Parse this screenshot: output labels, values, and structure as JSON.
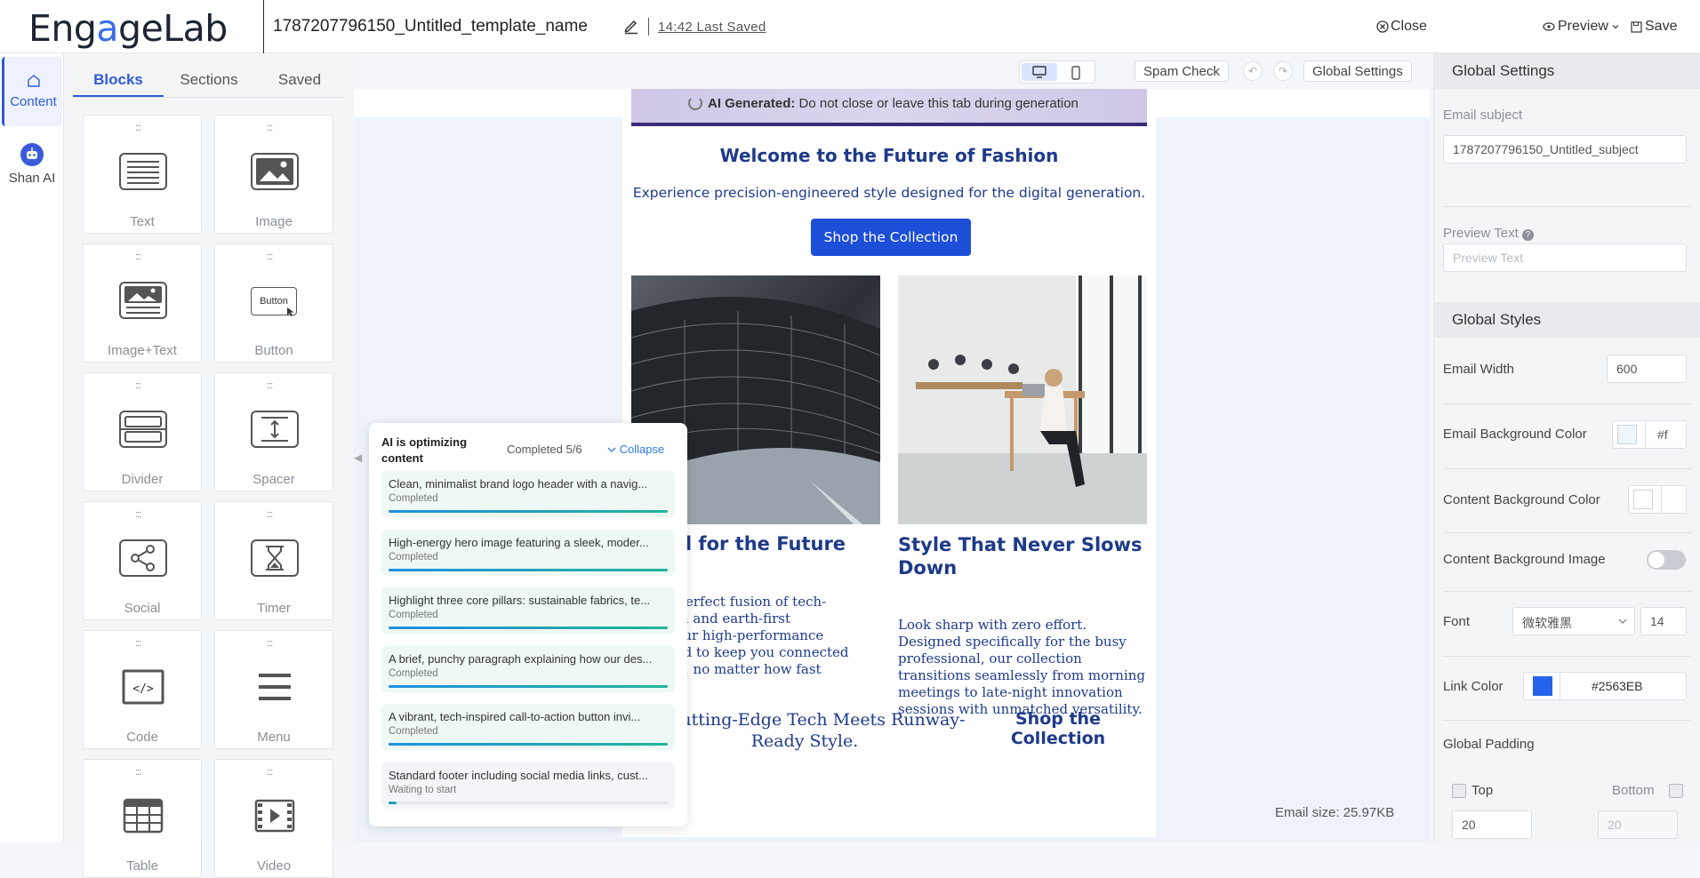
{
  "app": {
    "logo": "EngageLab",
    "template_name": "1787207796150_Untitled_template_name",
    "last_saved": "14:42 Last Saved",
    "close_label": "Close",
    "preview_label": "Preview",
    "save_label": "Save"
  },
  "left_rail": {
    "items": [
      {
        "label": "Content",
        "icon": "content-icon",
        "active": true
      },
      {
        "label": "Shan AI",
        "icon": "robot-icon",
        "active": false
      }
    ]
  },
  "blocks_panel": {
    "tabs": [
      "Blocks",
      "Sections",
      "Saved"
    ],
    "active_tab": "Blocks",
    "blocks": [
      "Text",
      "Image",
      "Image+Text",
      "Button",
      "Divider",
      "Spacer",
      "Social",
      "Timer",
      "Code",
      "Menu",
      "Table",
      "Video"
    ],
    "button_icon_text": "Button"
  },
  "canvas_toolbar": {
    "spam_check": "Spam Check",
    "global_settings": "Global Settings"
  },
  "email": {
    "ai_banner_bold": "AI Generated:",
    "ai_banner_text": " Do not close or leave this tab during generation",
    "headline": "Welcome to the Future of Fashion",
    "subheadline": "Experience precision-engineered style designed for the digital generation.",
    "cta": "Shop the Collection",
    "col1_heading": "eered for the Future",
    "col1_text": "ce the perfect fusion of tech-\nd design and earth-first\nbility. Our high-performance\ne crafted to keep you connected\nfortable, no matter how fast\nmoves.",
    "col2_heading": "Style That Never Slows Down",
    "col2_text": "Look sharp with zero effort. Designed specifically for the busy professional, our collection transitions seamlessly from morning meetings to late-night innovation sessions with unmatched versatility.",
    "footer_text": "re Cutting-Edge Tech Meets Runway-\nReady Style.",
    "footer_cta": "Shop the Collection",
    "size": "Email size: 25.97KB"
  },
  "ai_panel": {
    "title": "AI is optimizing content",
    "progress_text": "Completed 5/6",
    "collapse_label": "Collapse",
    "tasks": [
      {
        "text": "Clean, minimalist brand logo header with a navig...",
        "status": "Completed",
        "progress": 1.0
      },
      {
        "text": "High-energy hero image featuring a sleek, moder...",
        "status": "Completed",
        "progress": 1.0
      },
      {
        "text": "Highlight three core pillars: sustainable fabrics, te...",
        "status": "Completed",
        "progress": 1.0
      },
      {
        "text": "A brief, punchy paragraph explaining how our des...",
        "status": "Completed",
        "progress": 1.0
      },
      {
        "text": "A vibrant, tech-inspired call-to-action button invi...",
        "status": "Completed",
        "progress": 1.0
      },
      {
        "text": "Standard footer including social media links, cust...",
        "status": "Waiting to start",
        "progress": 0.03
      }
    ]
  },
  "right_panel": {
    "global_settings_title": "Global Settings",
    "email_subject_label": "Email subject",
    "email_subject_value": "1787207796150_Untitled_subject",
    "preview_text_label": "Preview Text",
    "preview_text_placeholder": "Preview Text",
    "global_styles_title": "Global Styles",
    "email_width_label": "Email Width",
    "email_width_value": "600",
    "email_bg_label": "Email Background Color",
    "email_bg_value": "#f",
    "email_bg_color": "#eef5fb",
    "content_bg_label": "Content Background Color",
    "content_bg_color": "#ffffff",
    "content_bg_image_label": "Content Background Image",
    "font_label": "Font",
    "font_value": "微软雅黑",
    "font_size": "14",
    "link_color_label": "Link Color",
    "link_color_value": "#2563EB",
    "link_color": "#2563EB",
    "global_padding_label": "Global Padding",
    "top_label": "Top",
    "bottom_label": "Bottom",
    "top_value": "20",
    "bottom_value": "20"
  }
}
